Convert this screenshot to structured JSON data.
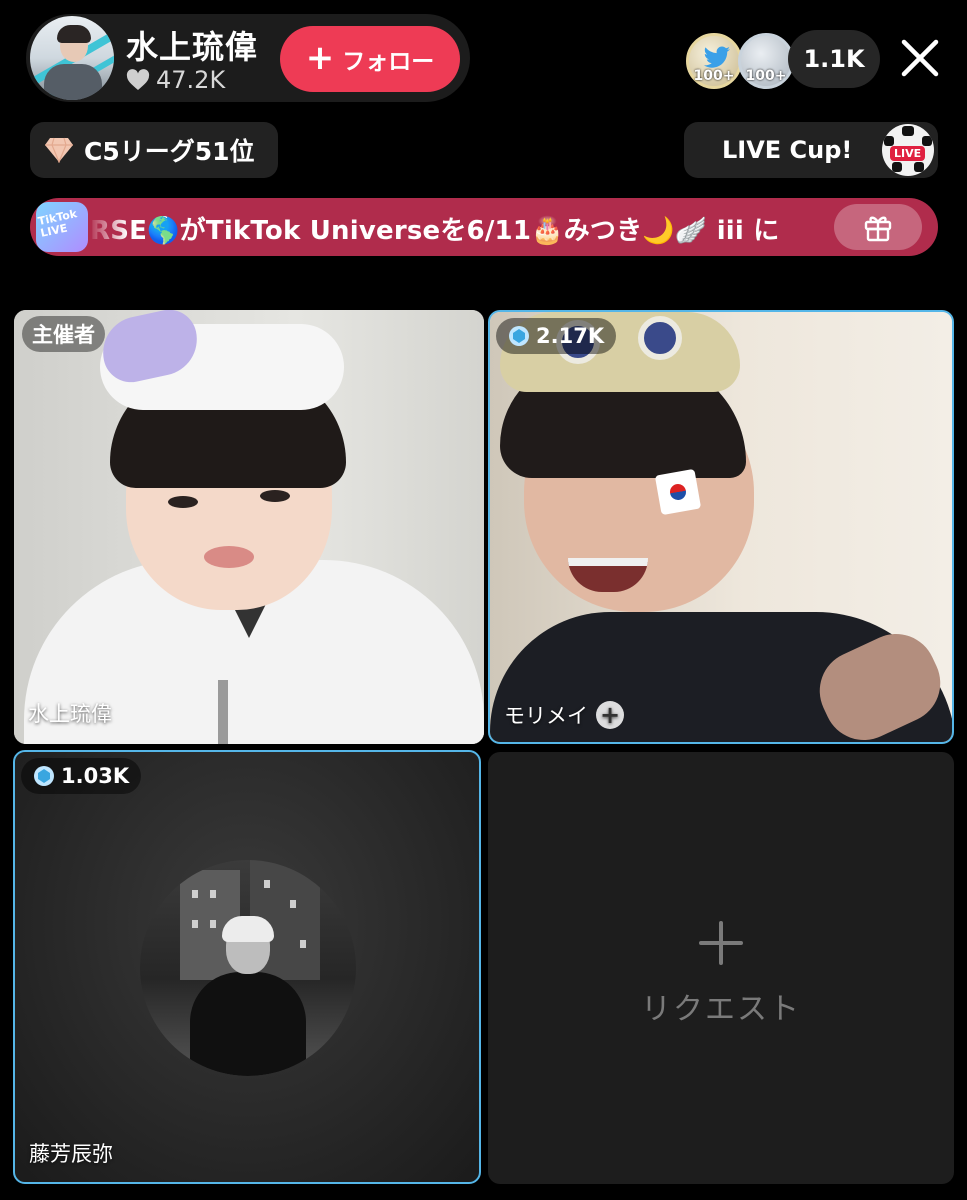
{
  "host": {
    "name": "水上琉偉",
    "likes": "47.2K",
    "follow_label": "フォロー"
  },
  "viewers": {
    "badge_1_count": "100+",
    "badge_2_count": "100+",
    "count": "1.1K"
  },
  "league": {
    "label": "C5リーグ51位"
  },
  "cup": {
    "label": "LIVE Cup!",
    "live_tag": "LIVE"
  },
  "banner": {
    "logo_text": "TikTok LIVE",
    "text": "RSE🌎がTikTok Universeを6/11🎂みつき🌙🪽 iii に"
  },
  "grid": {
    "host_cell": {
      "role_tag": "主催者",
      "name": "水上琉偉"
    },
    "guest1_cell": {
      "score": "2.17K",
      "name": "モリメイ"
    },
    "guest2_cell": {
      "score": "1.03K",
      "name": "藤芳辰弥"
    },
    "request_cell": {
      "label": "リクエスト"
    }
  },
  "colors": {
    "follow": "#ee3b55",
    "banner": "#b02c4c",
    "active_border": "#55b6e8"
  }
}
